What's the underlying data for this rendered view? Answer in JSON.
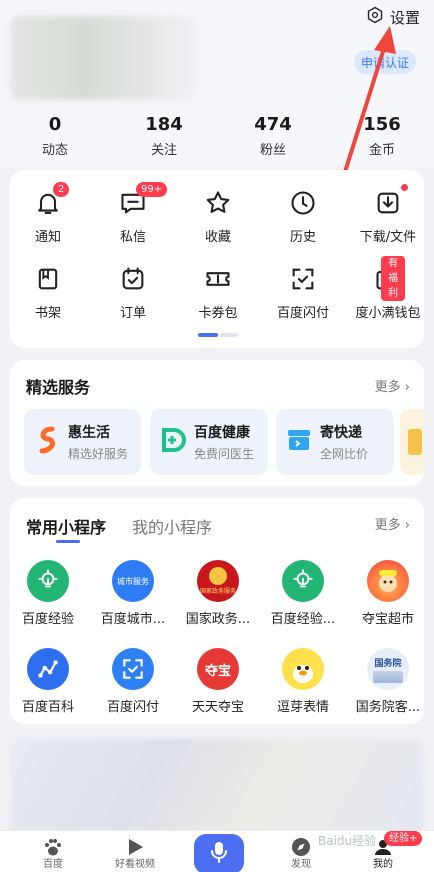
{
  "header": {
    "settings_label": "设置",
    "verify_label": "申请认证",
    "stats": [
      {
        "value": "0",
        "label": "动态"
      },
      {
        "value": "184",
        "label": "关注"
      },
      {
        "value": "474",
        "label": "粉丝"
      },
      {
        "value": "156",
        "label": "金币"
      }
    ]
  },
  "shortcuts": {
    "row1": [
      {
        "label": "通知",
        "icon": "bell-icon",
        "badge": "2"
      },
      {
        "label": "私信",
        "icon": "message-icon",
        "badge": "99+"
      },
      {
        "label": "收藏",
        "icon": "star-icon"
      },
      {
        "label": "历史",
        "icon": "clock-icon"
      },
      {
        "label": "下载/文件",
        "icon": "download-icon"
      }
    ],
    "row2": [
      {
        "label": "书架",
        "icon": "bookshelf-icon"
      },
      {
        "label": "订单",
        "icon": "order-icon"
      },
      {
        "label": "卡券包",
        "icon": "coupon-icon"
      },
      {
        "label": "百度闪付",
        "icon": "scan-pay-icon"
      },
      {
        "label": "度小满钱包",
        "icon": "wallet-icon",
        "badge": "有福利"
      }
    ]
  },
  "services": {
    "title": "精选服务",
    "more": "更多",
    "items": [
      {
        "title": "惠生活",
        "subtitle": "精选好服务",
        "color": "#ff6a2b"
      },
      {
        "title": "百度健康",
        "subtitle": "免费问医生",
        "color": "#1ec28b"
      },
      {
        "title": "寄快递",
        "subtitle": "全网比价",
        "color": "#2fa6f5"
      }
    ]
  },
  "miniapps": {
    "tab_active": "常用小程序",
    "tab_inactive": "我的小程序",
    "more": "更多",
    "row1": [
      {
        "label": "百度经验",
        "icon": "bulb-icon"
      },
      {
        "label": "百度城市...",
        "icon": "city-service-icon",
        "inner": "城市服务"
      },
      {
        "label": "国家政务...",
        "icon": "emblem-icon",
        "inner": "国家政务服务"
      },
      {
        "label": "百度经验...",
        "icon": "bulb-icon"
      },
      {
        "label": "夺宝超市",
        "icon": "treasure-market-icon"
      }
    ],
    "row2": [
      {
        "label": "百度百科",
        "icon": "baike-icon"
      },
      {
        "label": "百度闪付",
        "icon": "scan-pay-icon"
      },
      {
        "label": "天天夺宝",
        "icon": "treasure-icon",
        "inner": "夺宝"
      },
      {
        "label": "逗芽表情",
        "icon": "duck-icon"
      },
      {
        "label": "国务院客...",
        "icon": "state-council-icon",
        "inner": "国务院"
      }
    ]
  },
  "nav": {
    "items": [
      {
        "label": "百度",
        "icon": "paw-icon"
      },
      {
        "label": "好看视频",
        "icon": "play-icon"
      },
      {
        "label": "发现",
        "icon": "compass-icon"
      },
      {
        "label": "我的",
        "icon": "profile-icon",
        "badge": "经验+"
      }
    ]
  },
  "watermark": "Baidu经验",
  "colors": {
    "accent": "#4e6ef2",
    "badge": "#ff3b4e",
    "arrow": "#f0453a"
  }
}
